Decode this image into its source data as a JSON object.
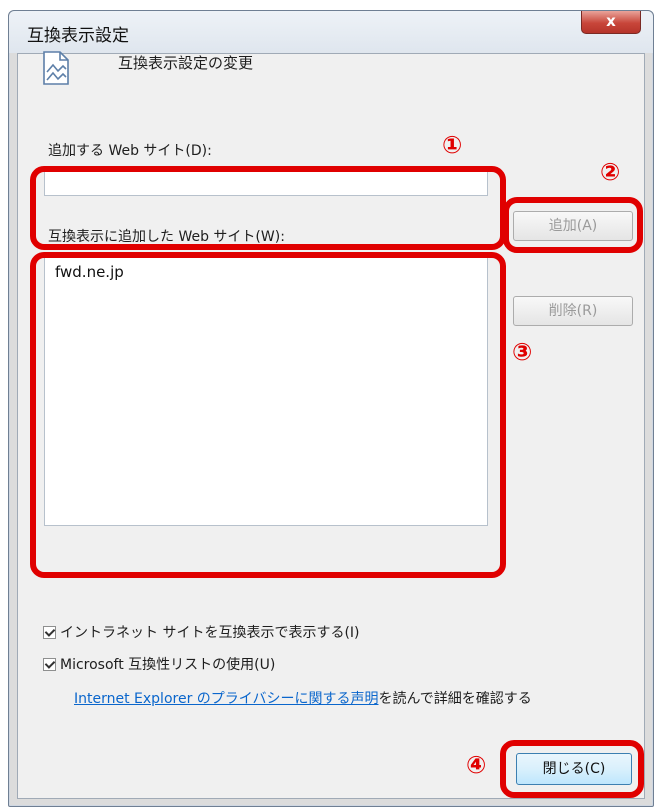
{
  "window": {
    "title": "互換表示設定",
    "close_label": "x"
  },
  "header": {
    "text": "互換表示設定の変更",
    "icon": "page-icon"
  },
  "add_site": {
    "label": "追加する Web サイト(D):",
    "input_value": "",
    "button_label": "追加(A)"
  },
  "added_sites": {
    "label": "互換表示に追加した Web サイト(W):",
    "items": [
      "fwd.ne.jp"
    ],
    "remove_label": "削除(R)"
  },
  "options": {
    "intranet": {
      "label": "イントラネット サイトを互換表示で表示する(I)",
      "checked": true
    },
    "ms_list": {
      "label": "Microsoft 互換性リストの使用(U)",
      "checked": true
    }
  },
  "privacy": {
    "link_text": "Internet Explorer のプライバシーに関する声明",
    "suffix_text": "を読んで詳細を確認する"
  },
  "close_button": {
    "label": "閉じる(C)"
  },
  "annotations": {
    "color": "#e00000",
    "markers": [
      "①",
      "②",
      "③",
      "④"
    ]
  }
}
